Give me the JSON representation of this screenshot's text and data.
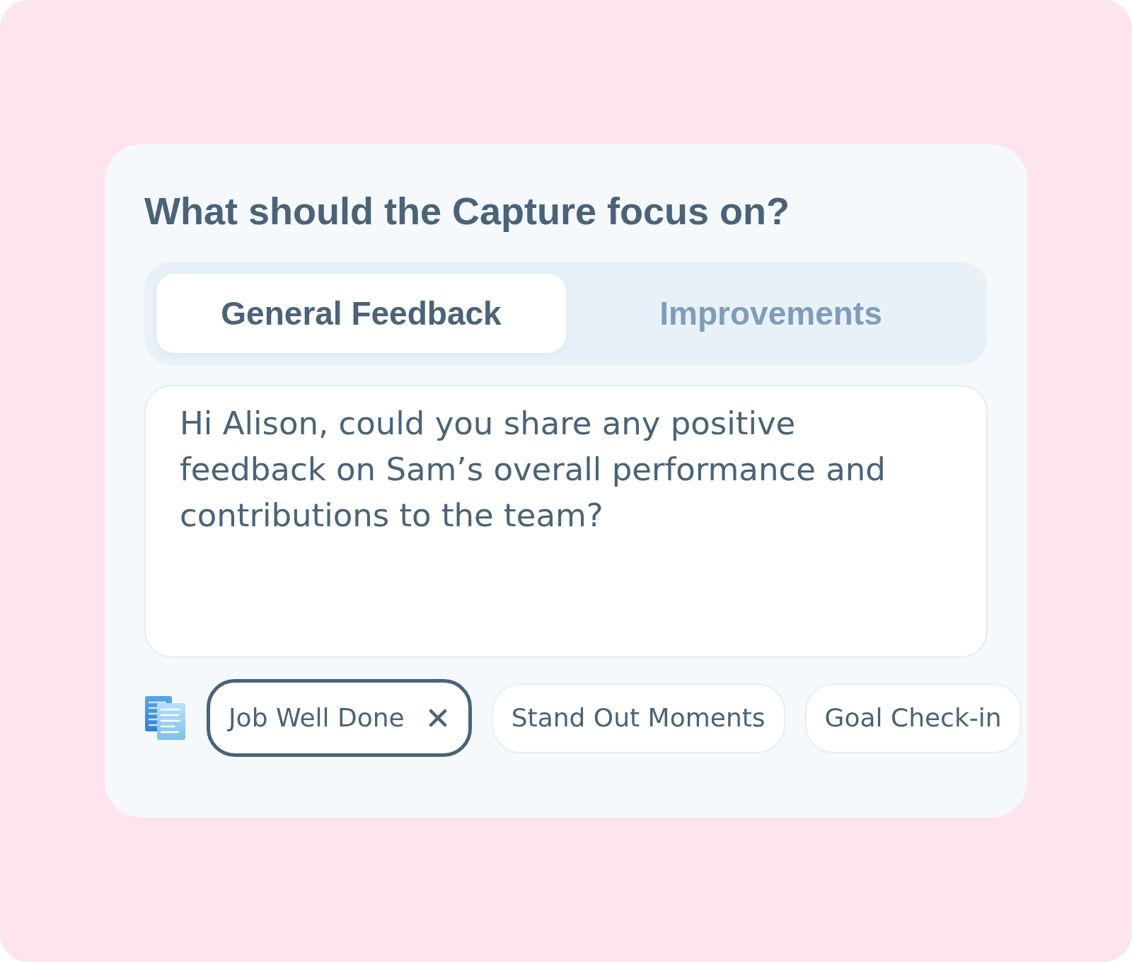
{
  "title": "What should the Capture focus on?",
  "tabs": [
    {
      "label": "General Feedback",
      "selected": true
    },
    {
      "label": "Improvements",
      "selected": false
    }
  ],
  "message": {
    "value": "Hi Alison, could you share any positive feedback on Sam’s overall performance and contributions to the team?"
  },
  "chips": [
    {
      "label": "Job Well Done",
      "selected": true
    },
    {
      "label": "Stand Out Moments",
      "selected": false
    },
    {
      "label": "Goal Check-in",
      "selected": false
    }
  ]
}
